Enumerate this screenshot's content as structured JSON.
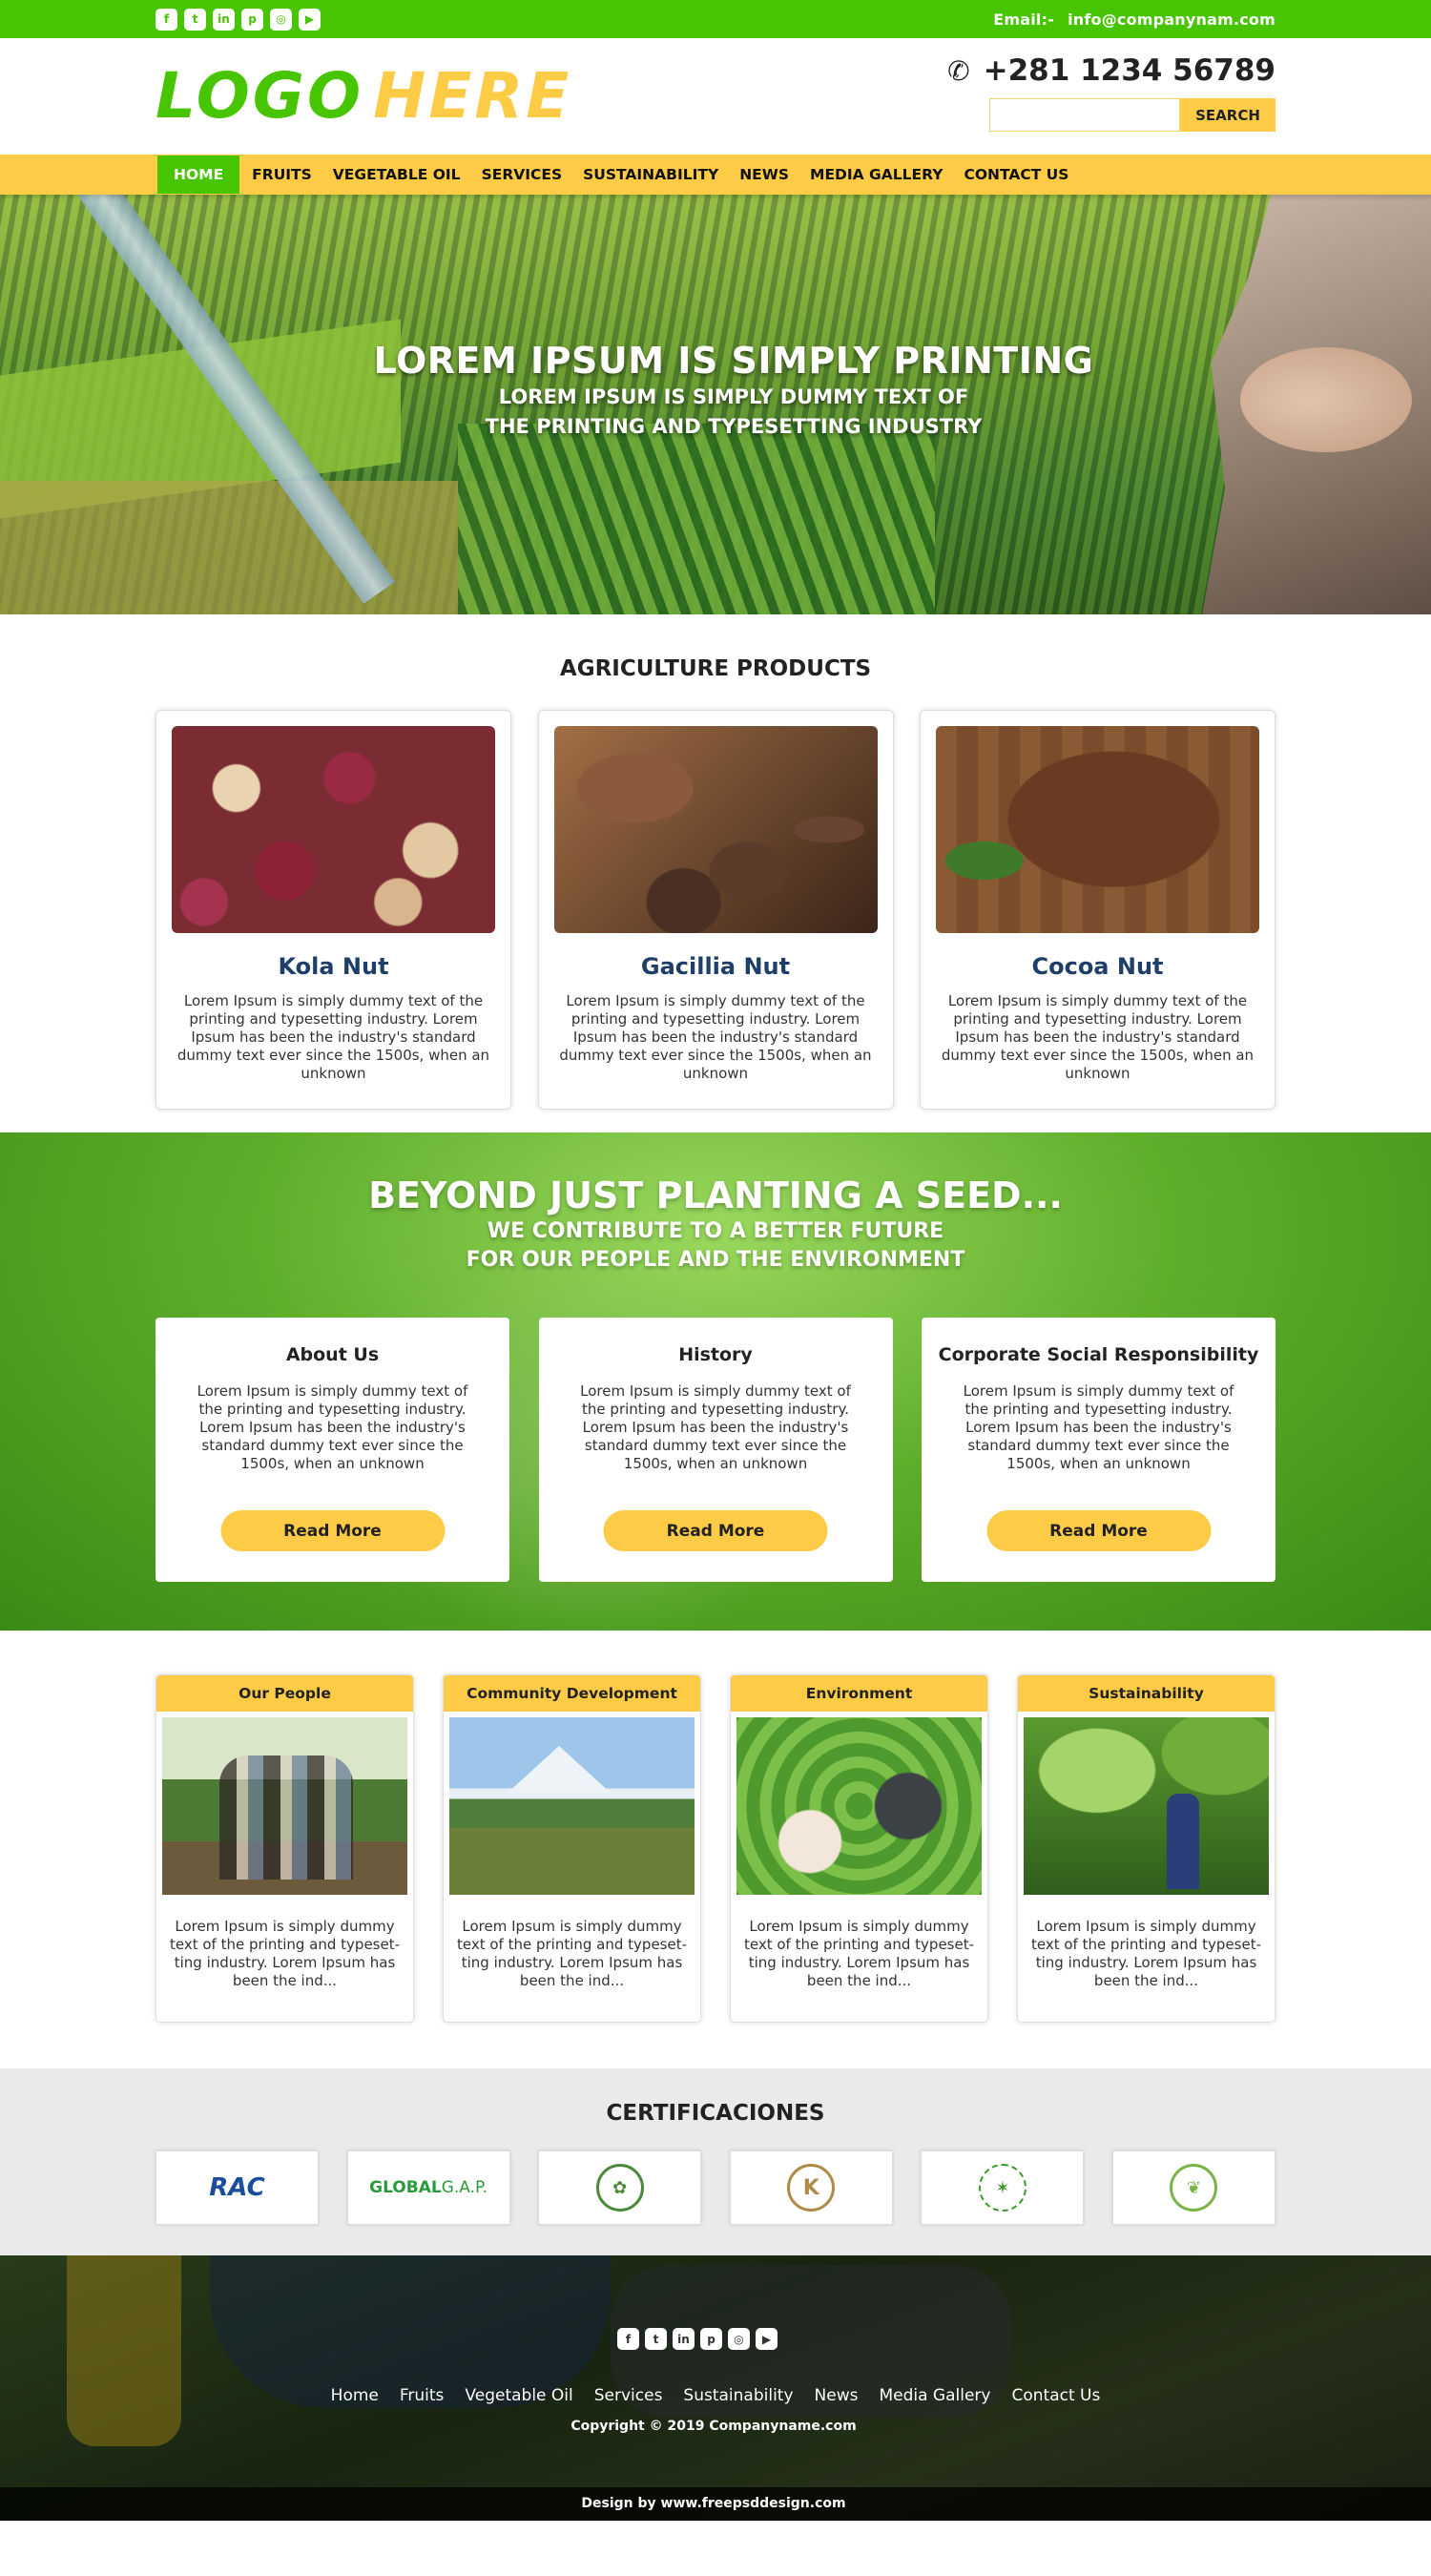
{
  "topbar": {
    "social_icons": [
      "facebook-icon",
      "twitter-icon",
      "linkedin-icon",
      "pinterest-icon",
      "instagram-icon",
      "youtube-icon"
    ],
    "email_label": "Email:-",
    "email": "info@companynam.com"
  },
  "header": {
    "logo_part1": "LOGO",
    "logo_part2": "HERE",
    "phone": "+281  1234 56789",
    "search_placeholder": "",
    "search_button": "SEARCH"
  },
  "nav": {
    "items": [
      "HOME",
      "FRUITS",
      "VEGETABLE OIL",
      "SERVICES",
      "SUSTAINABILITY",
      "NEWS",
      "MEDIA GALLERY",
      "CONTACT US"
    ],
    "active": "HOME"
  },
  "hero": {
    "title": "LOREM IPSUM IS SIMPLY  PRINTING",
    "sub_line1": "LOREM IPSUM IS SIMPLY DUMMY TEXT OF",
    "sub_line2": "THE PRINTING AND TYPESETTING INDUSTRY"
  },
  "products": {
    "title": "AGRICULTURE PRODUCTS",
    "items": [
      {
        "name": "Kola Nut",
        "desc": "Lorem Ipsum is simply dummy text of the printing and typesetting industry. Lorem Ipsum has been the industry's standard dummy text ever since the 1500s, when an unknown"
      },
      {
        "name": "Gacillia Nut",
        "desc": "Lorem Ipsum is simply dummy text of the printing and typesetting industry. Lorem Ipsum has been the industry's standard dummy text ever since the 1500s, when an unknown"
      },
      {
        "name": "Cocoa Nut",
        "desc": "Lorem Ipsum is simply dummy text of the printing and typesetting industry. Lorem Ipsum has been the industry's standard dummy text ever since the 1500s, when an unknown"
      }
    ]
  },
  "seed": {
    "title": "BEYOND JUST PLANTING A SEED...",
    "sub_line1": "WE CONTRIBUTE TO A BETTER FUTURE",
    "sub_line2": "FOR OUR PEOPLE AND THE ENVIRONMENT",
    "cards": [
      {
        "title": "About Us",
        "desc": "Lorem Ipsum is simply dummy text of the printing and typesetting industry. Lorem Ipsum has been the industry's standard dummy text ever since the 1500s, when an unknown",
        "button": "Read More"
      },
      {
        "title": "History",
        "desc": "Lorem Ipsum is simply dummy text of the printing and typesetting industry. Lorem Ipsum has been the industry's standard dummy text ever since the 1500s, when an unknown",
        "button": "Read More"
      },
      {
        "title": "Corporate Social Responsibility",
        "desc": "Lorem Ipsum is simply dummy text of the printing and typesetting industry. Lorem Ipsum has been the industry's standard dummy text ever since the 1500s, when an unknown",
        "button": "Read More"
      }
    ]
  },
  "features": [
    {
      "title": "Our People",
      "desc": "Lorem Ipsum is simply dummy text of the printing and typeset-ting industry. Lorem Ipsum has been the ind..."
    },
    {
      "title": "Community Development",
      "desc": "Lorem Ipsum is simply dummy text of the printing and typeset-ting industry. Lorem Ipsum has been the ind..."
    },
    {
      "title": "Environment",
      "desc": "Lorem Ipsum is simply dummy text of the printing and typeset-ting industry. Lorem Ipsum has been the ind..."
    },
    {
      "title": "Sustainability",
      "desc": "Lorem Ipsum is simply dummy text of the printing and typeset-ting industry. Lorem Ipsum has been the ind..."
    }
  ],
  "certifications": {
    "title": "CERTIFICACIONES",
    "logos": [
      {
        "name": "rac",
        "text": "RAC"
      },
      {
        "name": "globalgap",
        "text": "GLOBAL",
        "text2": "G.A.P."
      },
      {
        "name": "seal-green",
        "text": "✿"
      },
      {
        "name": "kosher",
        "text": "K"
      },
      {
        "name": "rspo",
        "text": "✶"
      },
      {
        "name": "rainforest",
        "text": "❦"
      }
    ]
  },
  "footer": {
    "social_icons": [
      "facebook-icon",
      "twitter-icon",
      "linkedin-icon",
      "pinterest-icon",
      "instagram-icon",
      "youtube-icon"
    ],
    "links": [
      "Home",
      "Fruits",
      "Vegetable Oil",
      "Services",
      "Sustainability",
      "News",
      "Media Gallery",
      "Contact Us"
    ],
    "copyright": "Copyright © 2019 Companyname.com",
    "design_credit": "Design by www.freepsddesign.com"
  },
  "colors": {
    "green": "#47c500",
    "yellow": "#fdcb46",
    "navy": "#1f3f6a"
  }
}
